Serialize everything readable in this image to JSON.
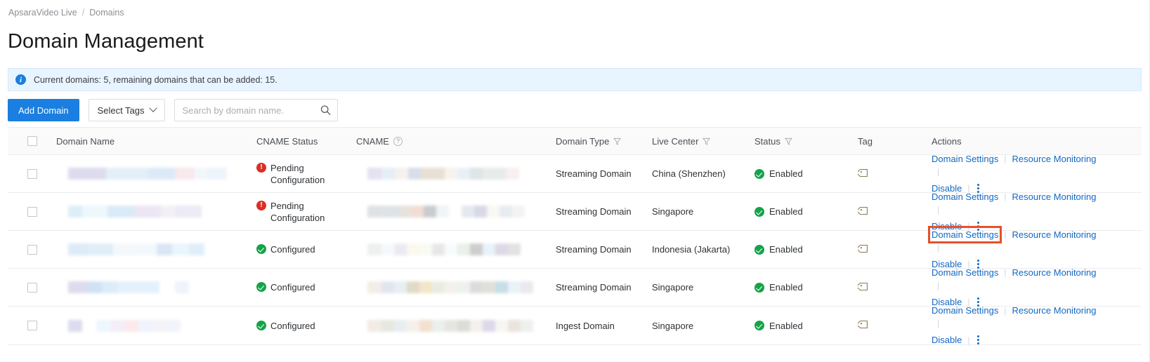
{
  "breadcrumb": {
    "root": "ApsaraVideo Live",
    "separator": "/",
    "current": "Domains"
  },
  "page_title": "Domain Management",
  "banner": {
    "icon": "info-icon",
    "text": "Current domains: 5, remaining domains that can be added: 15."
  },
  "toolbar": {
    "add_domain_label": "Add Domain",
    "select_tags_label": "Select Tags",
    "search_placeholder": "Search by domain name.",
    "search_value": "",
    "search_icon": "search-icon"
  },
  "table": {
    "columns": [
      {
        "key": "check",
        "label": ""
      },
      {
        "key": "name",
        "label": "Domain Name"
      },
      {
        "key": "cname_status",
        "label": "CNAME Status"
      },
      {
        "key": "cname",
        "label": "CNAME",
        "help": "?"
      },
      {
        "key": "type",
        "label": "Domain Type",
        "filter": true
      },
      {
        "key": "center",
        "label": "Live Center",
        "filter": true
      },
      {
        "key": "status",
        "label": "Status",
        "filter": true
      },
      {
        "key": "tag",
        "label": "Tag"
      },
      {
        "key": "actions",
        "label": "Actions"
      }
    ],
    "action_labels": {
      "domain_settings": "Domain Settings",
      "resource_monitoring": "Resource Monitoring",
      "disable": "Disable",
      "more": "more-kebab-icon",
      "separator": "|"
    },
    "rows": [
      {
        "cname_status": "Pending Configuration",
        "cname_status_state": "pending",
        "domain_type": "Streaming Domain",
        "live_center": "China (Shenzhen)",
        "status": "Enabled",
        "tag_icon": "tag-icon",
        "highlight_domain_settings": false
      },
      {
        "cname_status": "Pending Configuration",
        "cname_status_state": "pending",
        "domain_type": "Streaming Domain",
        "live_center": "Singapore",
        "status": "Enabled",
        "tag_icon": "tag-icon",
        "highlight_domain_settings": false
      },
      {
        "cname_status": "Configured",
        "cname_status_state": "configured",
        "domain_type": "Streaming Domain",
        "live_center": "Indonesia (Jakarta)",
        "status": "Enabled",
        "tag_icon": "tag-icon",
        "highlight_domain_settings": true
      },
      {
        "cname_status": "Configured",
        "cname_status_state": "configured",
        "domain_type": "Streaming Domain",
        "live_center": "Singapore",
        "status": "Enabled",
        "tag_icon": "tag-icon",
        "highlight_domain_settings": false
      },
      {
        "cname_status": "Configured",
        "cname_status_state": "configured",
        "domain_type": "Ingest Domain",
        "live_center": "Singapore",
        "status": "Enabled",
        "tag_icon": "tag-icon",
        "highlight_domain_settings": false
      }
    ]
  },
  "colors": {
    "accent": "#1a7fe0",
    "link": "#1268c3",
    "banner_bg": "#e8f4ff",
    "error": "#d93026",
    "success": "#15a34a",
    "highlight": "#e8502a"
  },
  "redaction": {
    "note": "domain names and CNAME values are visually blurred/obscured",
    "name_blurs": [
      [
        [
          "#dcdcee",
          54
        ],
        [
          "#e3eff7",
          60
        ],
        [
          "#dbeaf6",
          38
        ],
        [
          "#f7e9ec",
          28
        ],
        [
          "#f2f7fb",
          18
        ],
        [
          "#eef4fb",
          28
        ]
      ],
      [
        [
          "#dceef8",
          20
        ],
        [
          "#eef7fc",
          36
        ],
        [
          "#daeaf7",
          38
        ],
        [
          "#ece5f3",
          38
        ],
        [
          "#f3eff7",
          20
        ],
        [
          "#eceaf4",
          38
        ]
      ],
      [
        [
          "#dcebf7",
          28
        ],
        [
          "#e0eef8",
          36
        ],
        [
          "#f4f8fb",
          38
        ],
        [
          "#f2f9fc",
          24
        ],
        [
          "#d9e7f4",
          22
        ],
        [
          "#eaf6fc",
          24
        ],
        [
          "#dfeef9",
          22
        ]
      ],
      [
        [
          "#dcdcee",
          28
        ],
        [
          "#cfe3f5",
          20
        ],
        [
          "#dcecf8",
          22
        ],
        [
          "#e6f0fa",
          30
        ],
        [
          "#e4f1fb",
          30
        ],
        [
          "#ffffff",
          22
        ],
        [
          "#eef4fb",
          20
        ]
      ],
      [
        [
          "#dcdcee",
          20
        ],
        [
          "#ffffff",
          20
        ],
        [
          "#eff7fc",
          20
        ],
        [
          "#f3eef7",
          20
        ],
        [
          "#fbe9ec",
          20
        ],
        [
          "#eef4fb",
          20
        ],
        [
          "#f4f4f8",
          20
        ],
        [
          "#f1f4fa",
          20
        ]
      ]
    ],
    "cname_blurs": [
      [
        [
          "#e4e2f0",
          20
        ],
        [
          "#e6eef5",
          20
        ],
        [
          "#f5f2ee",
          18
        ],
        [
          "#d8dde9",
          18
        ],
        [
          "#e8e0d4",
          34
        ],
        [
          "#f6f3ee",
          18
        ],
        [
          "#e8f0f7",
          18
        ],
        [
          "#dfe4e6",
          18
        ],
        [
          "#e7ecea",
          34
        ],
        [
          "#f8f0ee",
          18
        ]
      ],
      [
        [
          "#dfe2e2",
          20
        ],
        [
          "#dde3e8",
          24
        ],
        [
          "#e6e2de",
          18
        ],
        [
          "#f0ddd4",
          18
        ],
        [
          "#c9cbd0",
          18
        ],
        [
          "#f0f5f6",
          18
        ],
        [
          "#ffffff",
          18
        ],
        [
          "#e4e9f0",
          18
        ],
        [
          "#d8d8e8",
          18
        ],
        [
          "#f8f8f4",
          18
        ],
        [
          "#e6ecf0",
          18
        ],
        [
          "#f2f4f2",
          18
        ]
      ],
      [
        [
          "#eef0ee",
          20
        ],
        [
          "#f6f9fb",
          18
        ],
        [
          "#eceaf1",
          18
        ],
        [
          "#fbf8ee",
          18
        ],
        [
          "#f9faf4",
          18
        ],
        [
          "#e7e7e7",
          18
        ],
        [
          "#f7fbfc",
          18
        ],
        [
          "#eaf0ea",
          18
        ],
        [
          "#cdcdcd",
          18
        ],
        [
          "#e8f2f8",
          18
        ],
        [
          "#dfd8e6",
          18
        ],
        [
          "#e2e2e2",
          18
        ]
      ],
      [
        [
          "#f2eee6",
          20
        ],
        [
          "#e0e6ee",
          18
        ],
        [
          "#e8eff2",
          18
        ],
        [
          "#e2dac8",
          18
        ],
        [
          "#f3e6c8",
          18
        ],
        [
          "#e9ece4",
          18
        ],
        [
          "#f4f0ea",
          18
        ],
        [
          "#eef2ee",
          18
        ],
        [
          "#dcdcdc",
          18
        ],
        [
          "#e0e0da",
          18
        ],
        [
          "#c8dee6",
          18
        ],
        [
          "#eaf2f8",
          18
        ],
        [
          "#ece8f0",
          18
        ]
      ],
      [
        [
          "#f2ebe6",
          20
        ],
        [
          "#e6e8e0",
          18
        ],
        [
          "#e6eef0",
          18
        ],
        [
          "#f6f0ec",
          18
        ],
        [
          "#f4e0ce",
          18
        ],
        [
          "#eaf0ec",
          18
        ],
        [
          "#e6e6e0",
          18
        ],
        [
          "#dcdcd8",
          18
        ],
        [
          "#f4f0ec",
          18
        ],
        [
          "#ddd9ea",
          18
        ],
        [
          "#f8f6f2",
          18
        ],
        [
          "#eae4dc",
          18
        ],
        [
          "#edf0ee",
          18
        ]
      ]
    ]
  }
}
